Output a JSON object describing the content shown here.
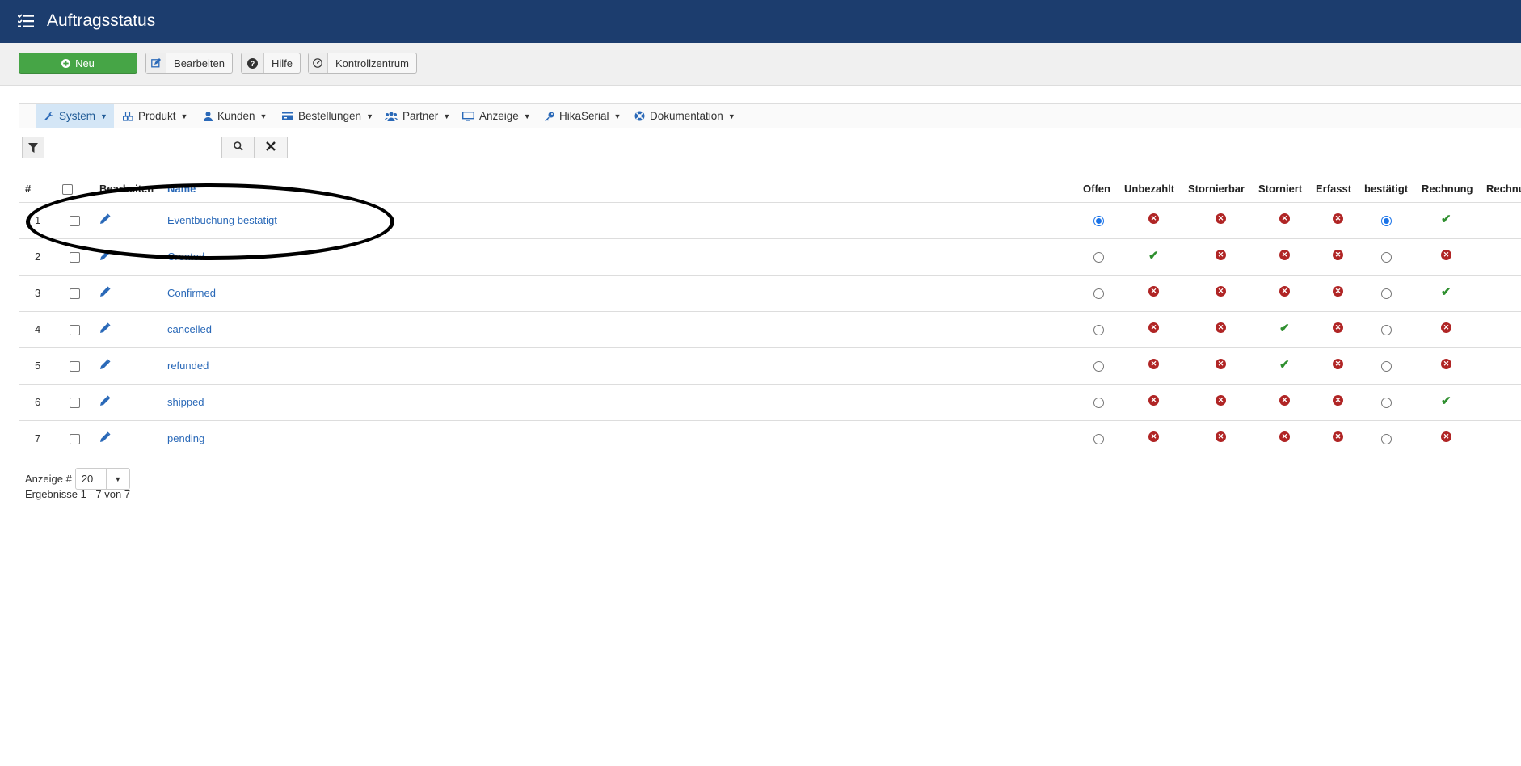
{
  "header": {
    "title": "Auftragsstatus",
    "icon": "list-check-icon",
    "bg_color": "#1c3d6e"
  },
  "toolbar": {
    "new_label": "Neu",
    "edit_label": "Bearbeiten",
    "help_label": "Hilfe",
    "control_label": "Kontrollzentrum",
    "new_color": "#46a546"
  },
  "nav": {
    "items": [
      {
        "label": "System",
        "icon": "wrench-icon",
        "active": true
      },
      {
        "label": "Produkt",
        "icon": "cubes-icon"
      },
      {
        "label": "Kunden",
        "icon": "user-icon"
      },
      {
        "label": "Bestellungen",
        "icon": "credit-card-icon"
      },
      {
        "label": "Partner",
        "icon": "users-icon"
      },
      {
        "label": "Anzeige",
        "icon": "monitor-icon"
      },
      {
        "label": "HikaSerial",
        "icon": "key-icon"
      },
      {
        "label": "Dokumentation",
        "icon": "lifebuoy-icon"
      }
    ]
  },
  "filter": {
    "search_value": "",
    "search_placeholder": ""
  },
  "table": {
    "headers": {
      "num": "#",
      "edit": "Bearbeiten",
      "name": "Name",
      "cols": [
        "Offen",
        "Unbezahlt",
        "Stornierbar",
        "Storniert",
        "Erfasst",
        "bestätigt",
        "Rechnung",
        "Rechnu"
      ]
    },
    "rows": [
      {
        "num": "1",
        "name": "Eventbuchung bestätigt",
        "offen": true,
        "flags": [
          "x",
          "x",
          "x",
          "x"
        ],
        "bestaetigt": true,
        "rechnung": "check"
      },
      {
        "num": "2",
        "name": "Created",
        "offen": false,
        "flags": [
          "check",
          "x",
          "x",
          "x"
        ],
        "bestaetigt": false,
        "rechnung": "x"
      },
      {
        "num": "3",
        "name": "Confirmed",
        "offen": false,
        "flags": [
          "x",
          "x",
          "x",
          "x"
        ],
        "bestaetigt": false,
        "rechnung": "check"
      },
      {
        "num": "4",
        "name": "cancelled",
        "offen": false,
        "flags": [
          "x",
          "x",
          "check",
          "x"
        ],
        "bestaetigt": false,
        "rechnung": "x"
      },
      {
        "num": "5",
        "name": "refunded",
        "offen": false,
        "flags": [
          "x",
          "x",
          "check",
          "x"
        ],
        "bestaetigt": false,
        "rechnung": "x"
      },
      {
        "num": "6",
        "name": "shipped",
        "offen": false,
        "flags": [
          "x",
          "x",
          "x",
          "x"
        ],
        "bestaetigt": false,
        "rechnung": "check"
      },
      {
        "num": "7",
        "name": "pending",
        "offen": false,
        "flags": [
          "x",
          "x",
          "x",
          "x"
        ],
        "bestaetigt": false,
        "rechnung": "x"
      }
    ]
  },
  "pagination": {
    "page_size_label": "Anzeige #",
    "page_size_value": "20",
    "results_text": "Ergebnisse 1 - 7 von 7"
  }
}
